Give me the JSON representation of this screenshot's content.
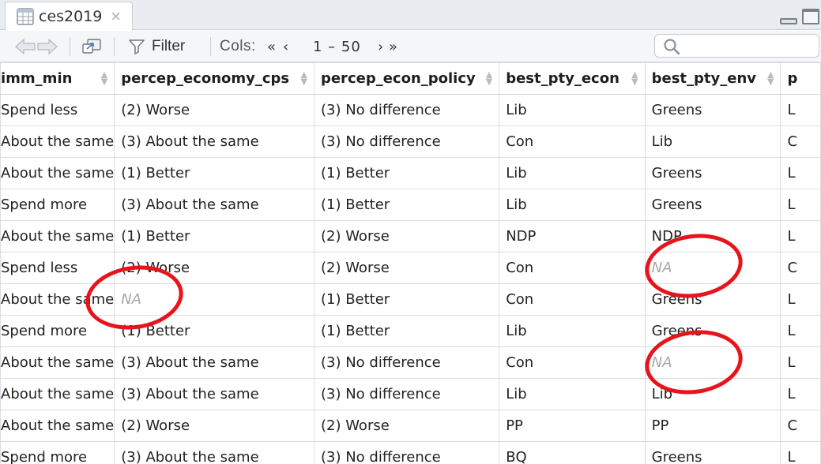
{
  "tab": {
    "title": "ces2019",
    "close_glyph": "×",
    "icon": "table-icon"
  },
  "toolbar": {
    "back_icon": "arrow-left-icon",
    "forward_icon": "arrow-right-icon",
    "popout_icon": "popout-icon",
    "filter_icon": "funnel-icon",
    "filter_label": "Filter",
    "cols_label": "Cols:",
    "first_glyph": "«",
    "prev_glyph": "‹",
    "range_label": "1 – 50",
    "next_glyph": "›",
    "last_glyph": "»",
    "search_icon": "search-icon",
    "search_value": ""
  },
  "grid": {
    "columns": [
      "imm_min",
      "percep_economy_cps",
      "percep_econ_policy",
      "best_pty_econ",
      "best_pty_env",
      "p"
    ],
    "rows": [
      [
        "Spend less",
        "(2) Worse",
        "(3) No difference",
        "Lib",
        "Greens",
        "L"
      ],
      [
        "About the same",
        "(3) About the same",
        "(3) No difference",
        "Con",
        "Lib",
        "C"
      ],
      [
        "About the same",
        "(1) Better",
        "(1) Better",
        "Lib",
        "Greens",
        "L"
      ],
      [
        "Spend more",
        "(3) About the same",
        "(1) Better",
        "Lib",
        "Greens",
        "L"
      ],
      [
        "About the same",
        "(1) Better",
        "(2) Worse",
        "NDP",
        "NDP",
        "L"
      ],
      [
        "Spend less",
        "(2) Worse",
        "(2) Worse",
        "Con",
        "NA",
        "C"
      ],
      [
        "About the same",
        "NA",
        "(1) Better",
        "Con",
        "Greens",
        "L"
      ],
      [
        "Spend more",
        "(1) Better",
        "(1) Better",
        "Lib",
        "Greens",
        "L"
      ],
      [
        "About the same",
        "(3) About the same",
        "(3) No difference",
        "Con",
        "NA",
        "L"
      ],
      [
        "About the same",
        "(3) About the same",
        "(3) No difference",
        "Lib",
        "Lib",
        "L"
      ],
      [
        "About the same",
        "(2) Worse",
        "(2) Worse",
        "PP",
        "PP",
        "C"
      ],
      [
        "Spend more",
        "(3) About the same",
        "(3) No difference",
        "BQ",
        "Greens",
        "L"
      ]
    ],
    "na_token": "NA"
  },
  "colors": {
    "annotation": "#e8141b",
    "na_text": "#a8a8a8",
    "border": "#d9dde3"
  }
}
